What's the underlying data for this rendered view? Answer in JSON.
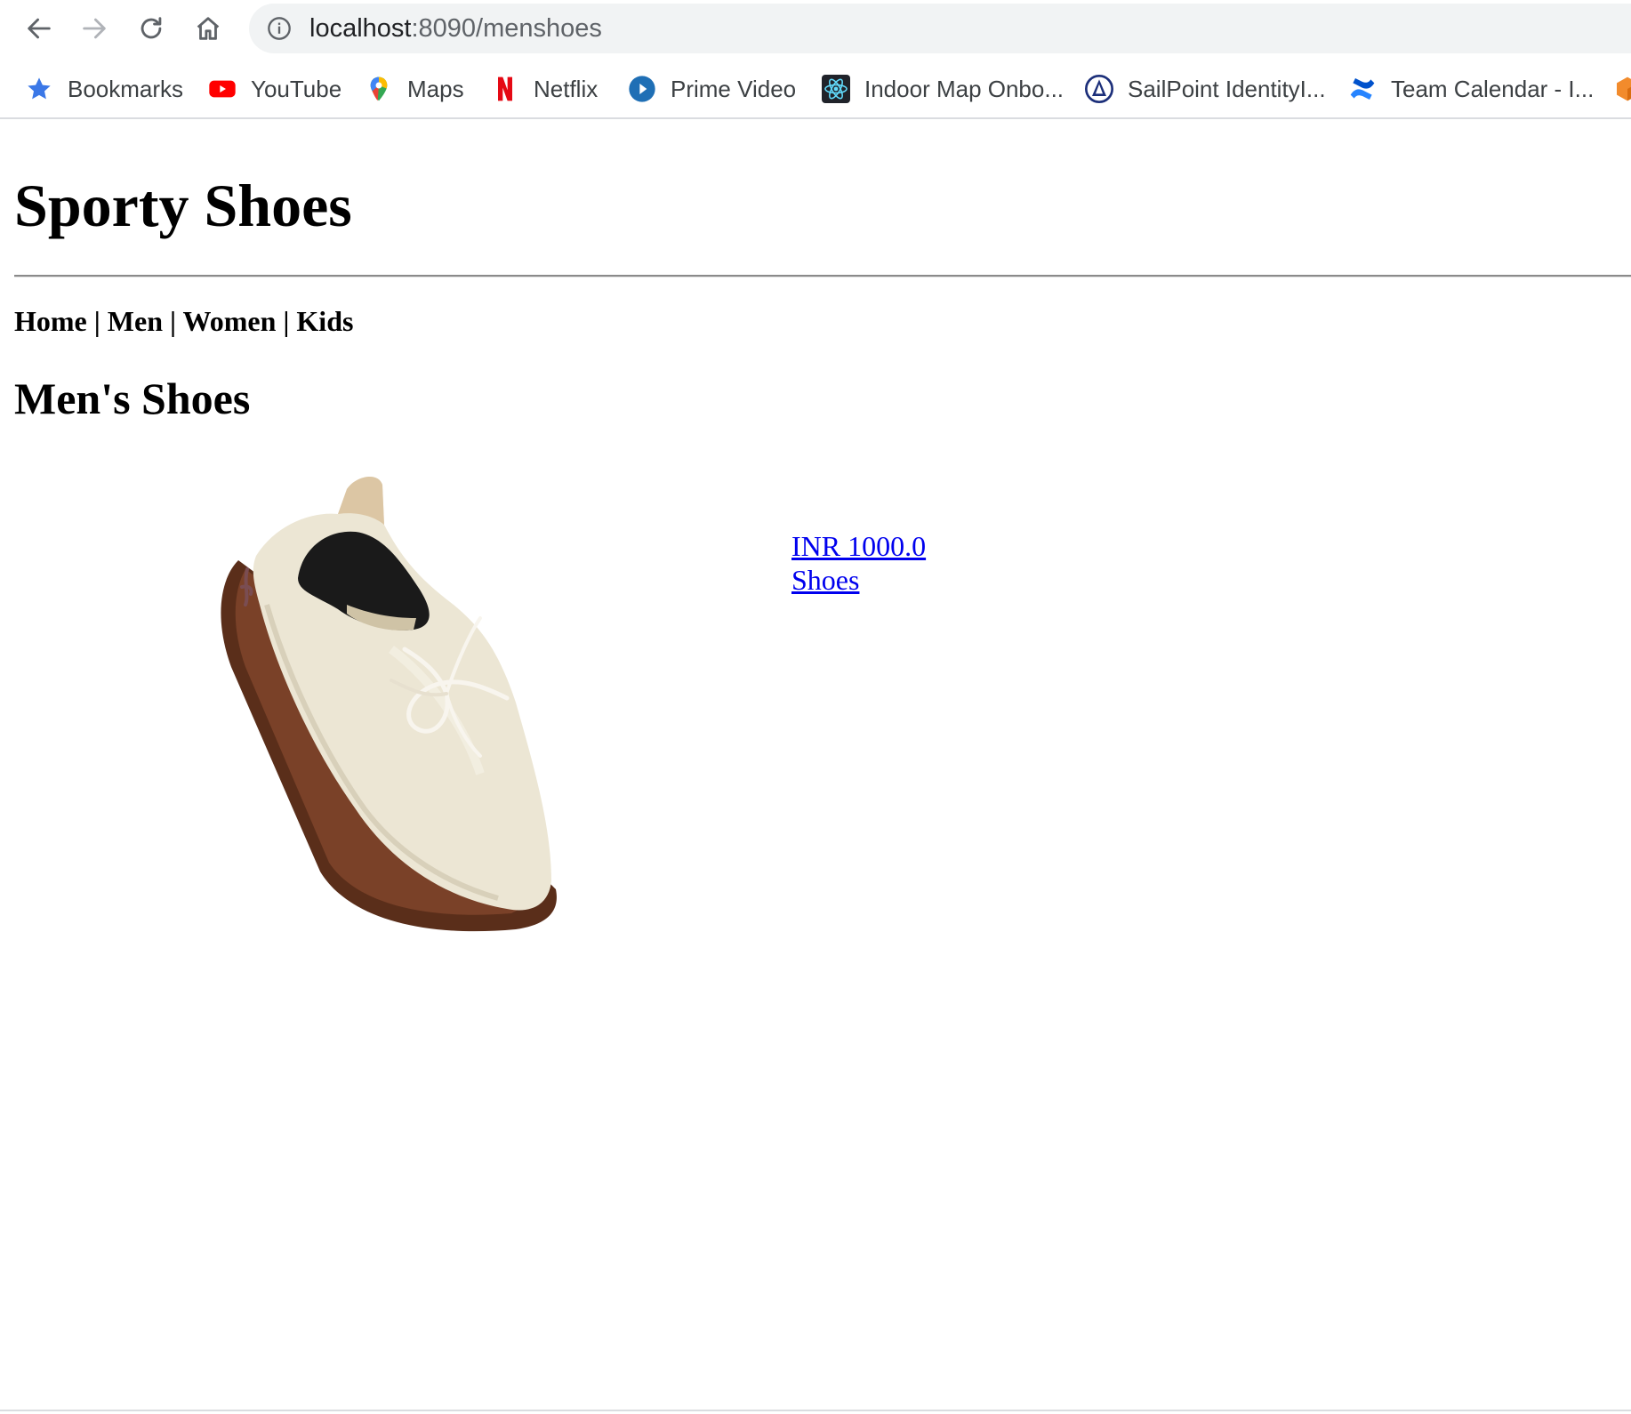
{
  "browser": {
    "url_host": "localhost",
    "url_path": ":8090/menshoes",
    "bookmarks": [
      {
        "label": "Bookmarks",
        "icon": "star-icon"
      },
      {
        "label": "YouTube",
        "icon": "youtube-icon"
      },
      {
        "label": "Maps",
        "icon": "maps-pin-icon"
      },
      {
        "label": "Netflix",
        "icon": "netflix-icon"
      },
      {
        "label": "Prime Video",
        "icon": "prime-video-icon"
      },
      {
        "label": "Indoor Map Onbo...",
        "icon": "react-atom-icon"
      },
      {
        "label": "SailPoint IdentityI...",
        "icon": "sailpoint-icon"
      },
      {
        "label": "Team Calendar - I...",
        "icon": "confluence-icon"
      }
    ]
  },
  "page": {
    "site_title": "Sporty Shoes",
    "menu": {
      "home": "Home",
      "men": "Men",
      "women": "Women",
      "kids": "Kids",
      "separator": " | "
    },
    "section_title": "Men's Shoes",
    "products": [
      {
        "price": "INR 1000.0",
        "name": "Shoes",
        "image": "sneaker-product-image"
      }
    ]
  },
  "colors": {
    "link": "#0000ee",
    "sole": "#5a2e1a",
    "knit": "#ece6d4"
  }
}
